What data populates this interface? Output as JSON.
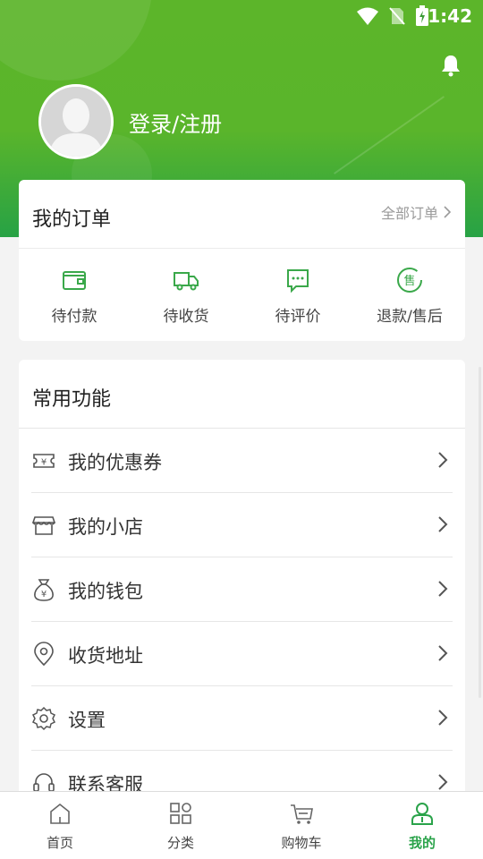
{
  "status": {
    "time": "1:42"
  },
  "user": {
    "login_label": "登录/注册"
  },
  "orders": {
    "title": "我的订单",
    "all_label": "全部订单",
    "items": [
      {
        "label": "待付款",
        "icon": "wallet-icon"
      },
      {
        "label": "待收货",
        "icon": "truck-icon"
      },
      {
        "label": "待评价",
        "icon": "chat-icon"
      },
      {
        "label": "退款/售后",
        "icon": "after-sale-icon"
      }
    ]
  },
  "functions": {
    "title": "常用功能",
    "items": [
      {
        "label": "我的优惠券",
        "icon": "coupon-icon"
      },
      {
        "label": "我的小店",
        "icon": "shop-icon"
      },
      {
        "label": "我的钱包",
        "icon": "money-bag-icon"
      },
      {
        "label": "收货地址",
        "icon": "location-icon"
      },
      {
        "label": "设置",
        "icon": "settings-icon"
      },
      {
        "label": "联系客服",
        "icon": "headset-icon"
      }
    ]
  },
  "nav": {
    "items": [
      {
        "label": "首页",
        "icon": "home-icon"
      },
      {
        "label": "分类",
        "icon": "category-icon"
      },
      {
        "label": "购物车",
        "icon": "cart-icon"
      },
      {
        "label": "我的",
        "icon": "user-icon"
      }
    ],
    "active_index": 3
  },
  "colors": {
    "brand_green": "#2aa34a",
    "header_green": "#5cb52a"
  }
}
